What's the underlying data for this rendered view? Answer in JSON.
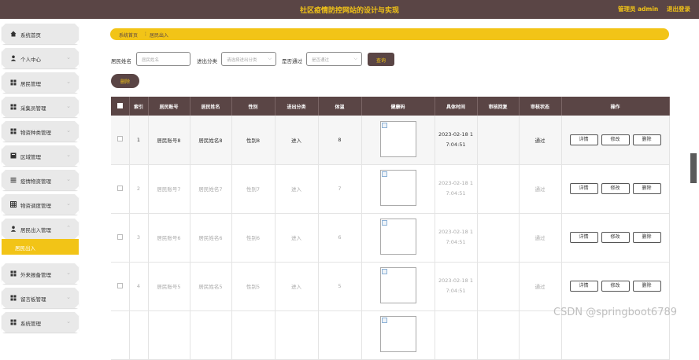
{
  "header": {
    "title": "社区疫情防控网站的设计与实现",
    "admin": "管理员 admin",
    "logout": "退出登录"
  },
  "sidebar": {
    "items": [
      {
        "label": "系统首页",
        "icon": "home-icon"
      },
      {
        "label": "个人中心",
        "icon": "user-icon"
      },
      {
        "label": "居民管理",
        "icon": "grid-icon"
      },
      {
        "label": "采集员管理",
        "icon": "grid-icon"
      },
      {
        "label": "物资种类管理",
        "icon": "grid-icon"
      },
      {
        "label": "区域管理",
        "icon": "box-icon"
      },
      {
        "label": "疫情物资管理",
        "icon": "list-icon"
      },
      {
        "label": "物资调度管理",
        "icon": "table-icon"
      },
      {
        "label": "居民出入管理",
        "icon": "user-icon"
      },
      {
        "label": "外来报备管理",
        "icon": "grid-icon"
      },
      {
        "label": "留言板管理",
        "icon": "grid-icon"
      },
      {
        "label": "系统管理",
        "icon": "grid-icon"
      }
    ],
    "active_sub": "居民出入"
  },
  "breadcrumb": {
    "root": "系统首页",
    "sep": "⋮",
    "current": "居民出入"
  },
  "search": {
    "name_label": "居民姓名",
    "name_placeholder": "居民姓名",
    "type_label": "进出分类",
    "type_placeholder": "请选择进出分类",
    "pass_label": "是否通过",
    "pass_placeholder": "是否通过",
    "search_button": "查询"
  },
  "delete_button": "删除",
  "table": {
    "headers": [
      "",
      "索引",
      "居民账号",
      "居民姓名",
      "性别",
      "进出分类",
      "体温",
      "健康码",
      "具体时间",
      "审核回复",
      "审核状态",
      "操作"
    ],
    "actions": [
      "详情",
      "修改",
      "删除"
    ],
    "rows": [
      {
        "index": "1",
        "account": "居民账号8",
        "name": "居民姓名8",
        "gender": "性别8",
        "type": "进入",
        "temp": "8",
        "time1": "2023-02-18 1",
        "time2": "7:04:51",
        "reply": "",
        "status": "通过"
      },
      {
        "index": "2",
        "account": "居民账号7",
        "name": "居民姓名7",
        "gender": "性别7",
        "type": "进入",
        "temp": "7",
        "time1": "2023-02-18 1",
        "time2": "7:04:51",
        "reply": "",
        "status": "通过"
      },
      {
        "index": "3",
        "account": "居民账号6",
        "name": "居民姓名6",
        "gender": "性别6",
        "type": "进入",
        "temp": "6",
        "time1": "2023-02-18 1",
        "time2": "7:04:51",
        "reply": "",
        "status": "通过"
      },
      {
        "index": "4",
        "account": "居民账号5",
        "name": "居民姓名5",
        "gender": "性别5",
        "type": "进入",
        "temp": "5",
        "time1": "2023-02-18 1",
        "time2": "7:04:51",
        "reply": "",
        "status": "通过"
      },
      {
        "index": "",
        "account": "",
        "name": "",
        "gender": "",
        "type": "",
        "temp": "",
        "time1": "",
        "time2": "",
        "reply": "",
        "status": ""
      }
    ]
  },
  "watermark": "CSDN @springboot6789",
  "colors": {
    "header": "#5a4545",
    "accent": "#f2c417"
  }
}
